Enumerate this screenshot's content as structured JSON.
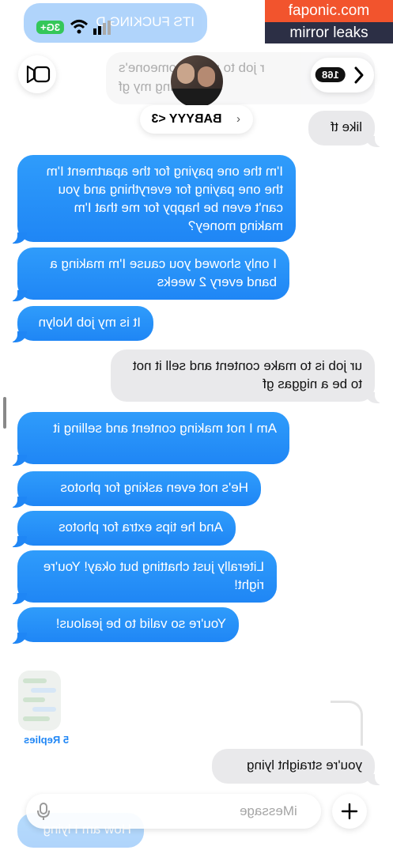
{
  "watermark": {
    "site": "faponic.com",
    "tag": "mirror leaks"
  },
  "status_bar": {
    "cellular": "3G+"
  },
  "header": {
    "contact_name": "BABYYY <3",
    "unread_count": "168",
    "top_partial_1": "ITS FUCKING D",
    "top_partial_2": "r job to make someone's",
    "top_partial_3": "ist being my gf"
  },
  "messages": [
    {
      "from": "them",
      "text": "like tf"
    },
    {
      "from": "me",
      "text": "I'm the one paying for the apartment I'm the one paying for everything and you can't even be happy for me that I'm making money?"
    },
    {
      "from": "me",
      "text": "I only showed you cause I'm making a band every 2 weeks"
    },
    {
      "from": "me",
      "text": "It is my job Nolyn"
    },
    {
      "from": "them",
      "text": "ur job is to make content and sell it not to be a niggas gf"
    },
    {
      "from": "me",
      "text": "Am I not making content and selling it"
    },
    {
      "from": "me",
      "text": "He's not even asking for photos"
    },
    {
      "from": "me",
      "text": "And he tips extra for photos"
    },
    {
      "from": "me",
      "text": "Literally just chatting but okay! You're right!"
    },
    {
      "from": "me",
      "text": "You're so valid to be jealous!"
    },
    {
      "from": "them",
      "text": "you're straight lying"
    },
    {
      "from": "me",
      "text": "How am I lying"
    }
  ],
  "thread": {
    "replies": "5 Replies"
  },
  "composer": {
    "placeholder": "iMessage"
  },
  "colors": {
    "blue": "#1f86f5",
    "gray": "#e9e9eb",
    "watermark_top": "#f2542d",
    "watermark_bottom": "#2c2f45"
  }
}
